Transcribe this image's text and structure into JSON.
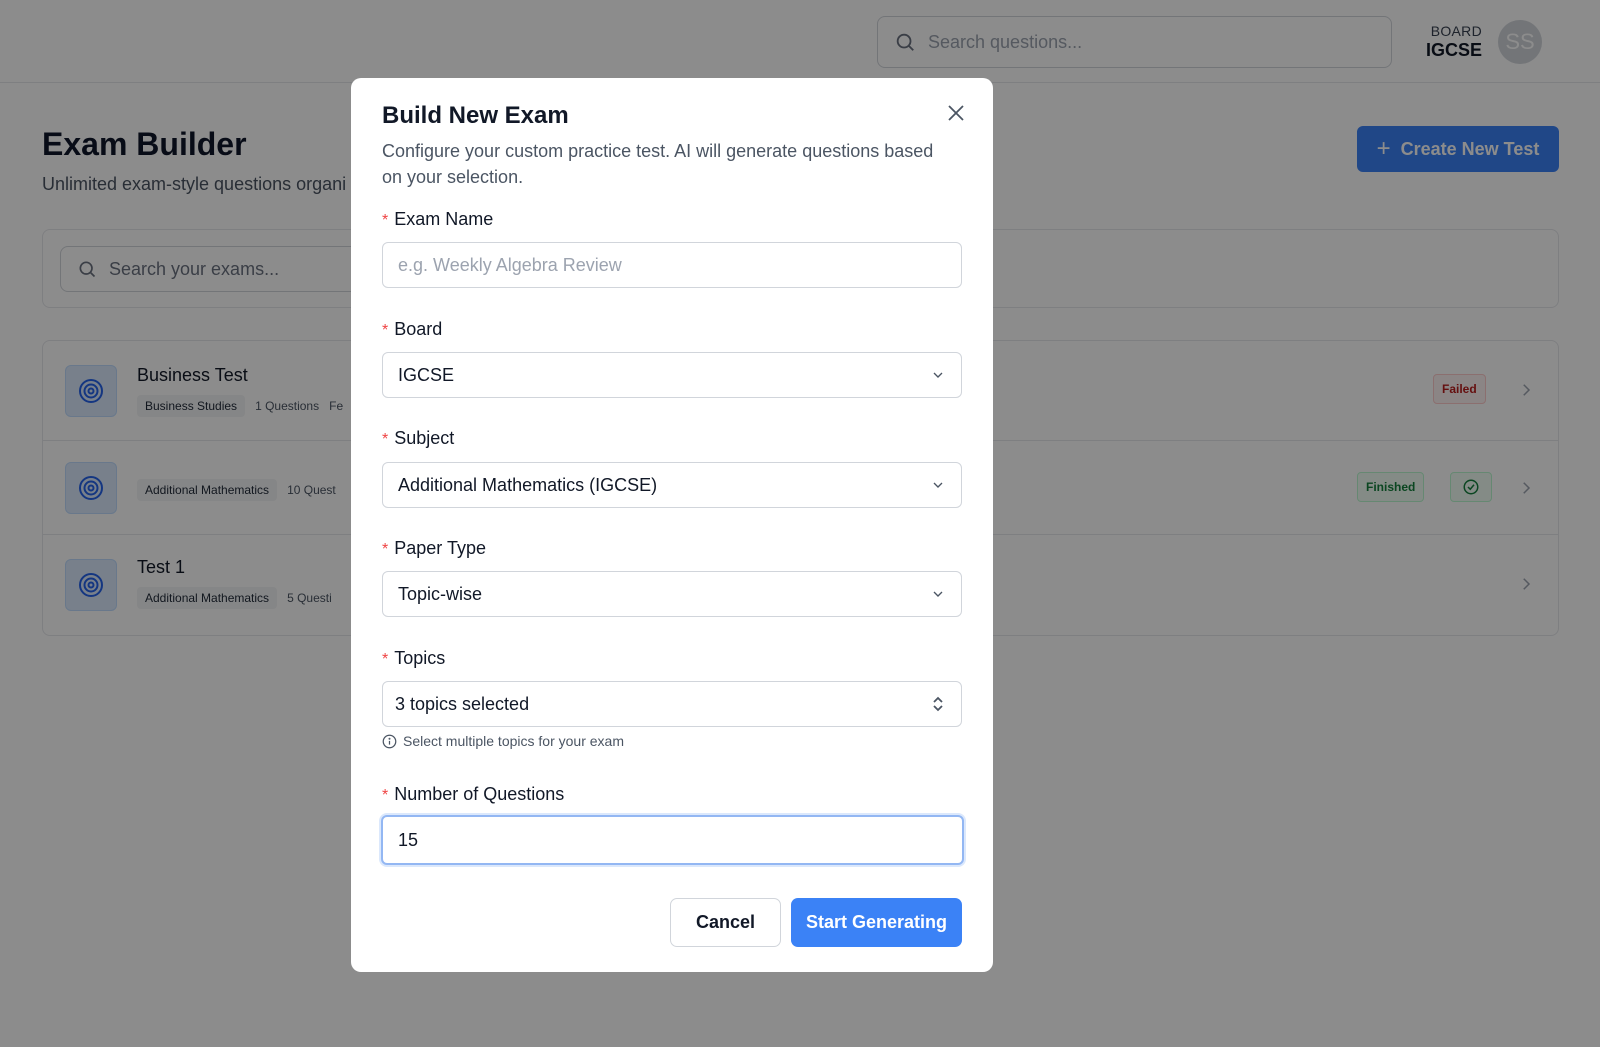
{
  "header": {
    "search_placeholder": "Search questions...",
    "board_label": "BOARD",
    "board_value": "IGCSE",
    "avatar_initials": "SS"
  },
  "page": {
    "title": "Exam Builder",
    "subtitle": "Unlimited exam-style questions organi",
    "create_button_label": "Create New Test",
    "exam_search_placeholder": "Search your exams..."
  },
  "exams": [
    {
      "name": "Business Test",
      "subject_tag": "Business Studies",
      "meta": "1 Questions",
      "meta_extra": "Fe",
      "status": "Failed"
    },
    {
      "name": "",
      "subject_tag": "Additional Mathematics",
      "meta": "10 Quest",
      "meta_extra": "",
      "status": "Finished"
    },
    {
      "name": "Test 1",
      "subject_tag": "Additional Mathematics",
      "meta": "5 Questi",
      "meta_extra": "",
      "status": ""
    }
  ],
  "modal": {
    "title": "Build New Exam",
    "description": "Configure your custom practice test. AI will generate questions based on your selection.",
    "required_marker": "*",
    "exam_name": {
      "label": "Exam Name",
      "value": "",
      "placeholder": "e.g. Weekly Algebra Review"
    },
    "board": {
      "label": "Board",
      "value": "IGCSE"
    },
    "subject": {
      "label": "Subject",
      "value": "Additional Mathematics (IGCSE)"
    },
    "paper_type": {
      "label": "Paper Type",
      "value": "Topic-wise"
    },
    "topics": {
      "label": "Topics",
      "value": "3 topics selected",
      "hint": "Select multiple topics for your exam"
    },
    "num_questions": {
      "label": "Number of Questions",
      "value": "15"
    },
    "cancel_label": "Cancel",
    "start_label": "Start Generating"
  },
  "colors": {
    "primary": "#3b82f6",
    "required": "#ef4444",
    "failed": "#b91c1c",
    "finished": "#15803d"
  }
}
